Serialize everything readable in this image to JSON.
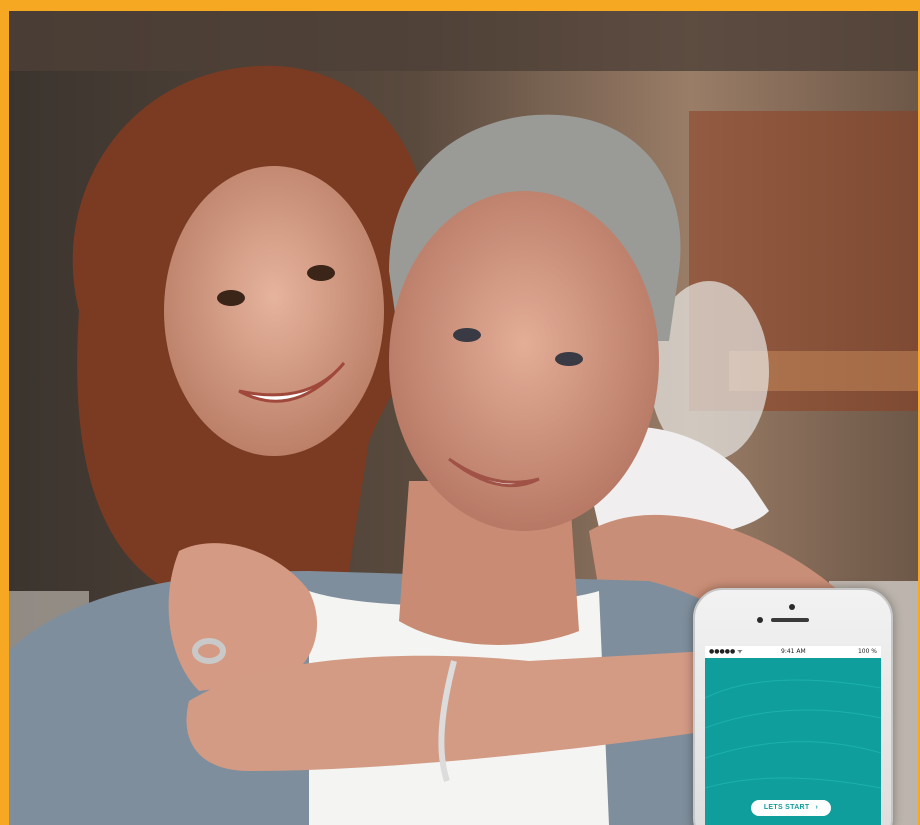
{
  "photo": {
    "subject": "couple-portrait",
    "colors": {
      "border": "#f7a823",
      "background": "#4a3d33",
      "skin": "#d9a08a",
      "woman_hair": "#7a3b22",
      "man_hair": "#9a9a96",
      "shirt": "#8a9aa8",
      "tee": "#f2f2f0"
    }
  },
  "phone": {
    "status": {
      "carrier": "●●●●● ᯤ",
      "time": "9:41 AM",
      "battery": "100 %"
    },
    "screen_color": "#0f9e9c",
    "start_button": {
      "label": "LETS START",
      "icon": "chevron-right-icon"
    }
  }
}
